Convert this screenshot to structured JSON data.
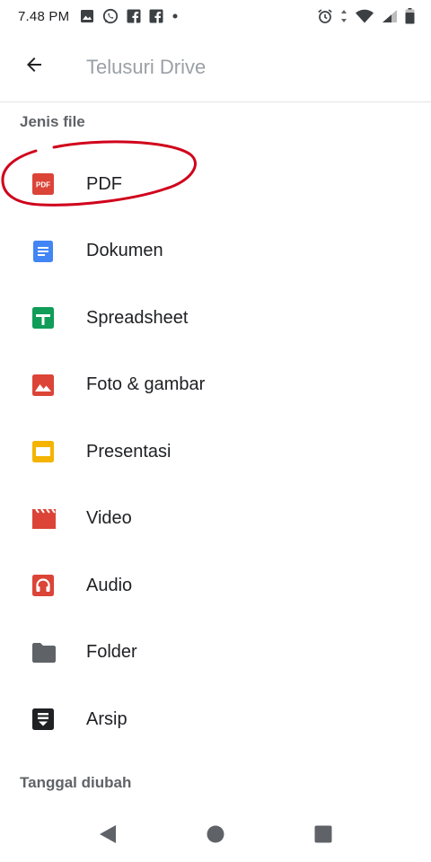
{
  "status_bar": {
    "time": "7.48 PM",
    "left_icons": [
      "image-icon",
      "whatsapp-icon",
      "facebook-icon",
      "facebook-icon",
      "more-dot-icon"
    ],
    "right_icons": [
      "alarm-icon",
      "data-arrows-icon",
      "wifi-icon",
      "signal-icon",
      "battery-icon"
    ]
  },
  "search": {
    "placeholder": "Telusuri Drive"
  },
  "sections": {
    "file_type_title": "Jenis file",
    "date_modified_title": "Tanggal diubah"
  },
  "file_types": [
    {
      "label": "PDF",
      "icon": "pdf-icon",
      "color": "#db4437"
    },
    {
      "label": "Dokumen",
      "icon": "document-icon",
      "color": "#4285f4"
    },
    {
      "label": "Spreadsheet",
      "icon": "spreadsheet-icon",
      "color": "#0f9d58"
    },
    {
      "label": "Foto & gambar",
      "icon": "image-icon",
      "color": "#db4437"
    },
    {
      "label": "Presentasi",
      "icon": "presentation-icon",
      "color": "#f4b400"
    },
    {
      "label": "Video",
      "icon": "video-icon",
      "color": "#db4437"
    },
    {
      "label": "Audio",
      "icon": "audio-icon",
      "color": "#db4437"
    },
    {
      "label": "Folder",
      "icon": "folder-icon",
      "color": "#5f6368"
    },
    {
      "label": "Arsip",
      "icon": "archive-icon",
      "color": "#202124"
    }
  ],
  "annotation_color": "#d0021b",
  "nav_bar": [
    "back-triangle-icon",
    "home-circle-icon",
    "recents-square-icon"
  ]
}
